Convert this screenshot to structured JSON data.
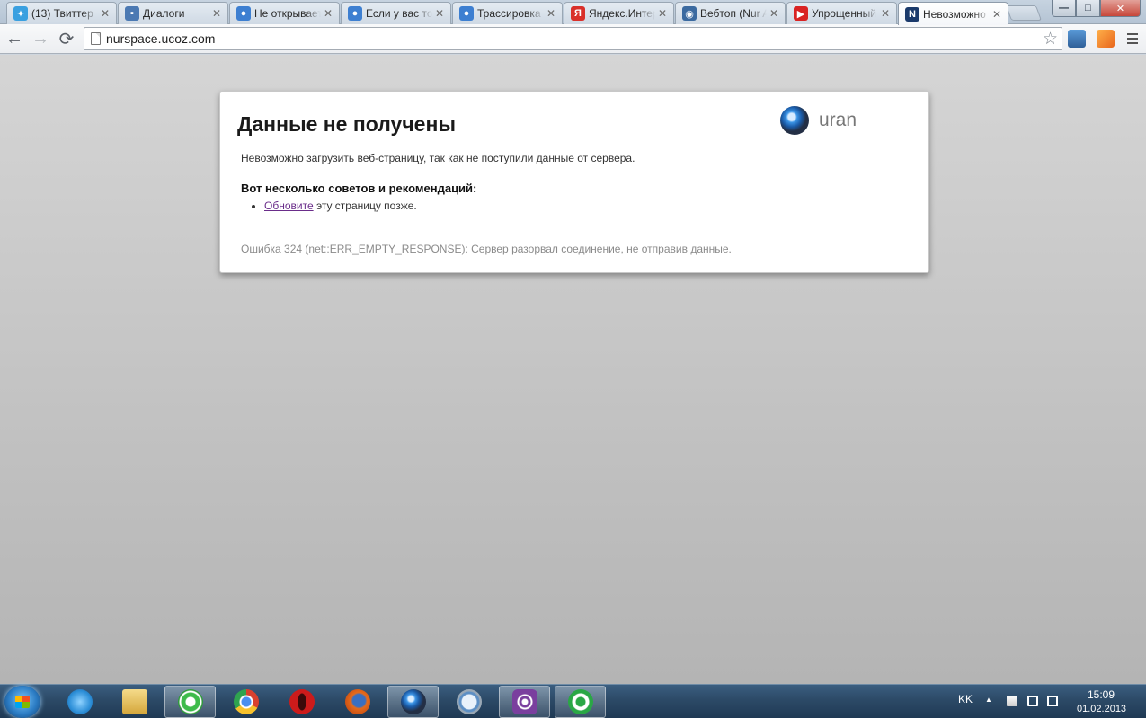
{
  "tabs": [
    {
      "label": "(13) Твиттер",
      "icon": "twitter-icon",
      "color": "#3aa0e0"
    },
    {
      "label": "Диалоги",
      "icon": "chat-icon",
      "color": "#4b79b3"
    },
    {
      "label": "Не открывается",
      "icon": "people-icon",
      "color": "#3d7fd1"
    },
    {
      "label": "Если у вас тормозит",
      "icon": "people-icon",
      "color": "#3d7fd1"
    },
    {
      "label": "Трассировка",
      "icon": "people-icon",
      "color": "#3d7fd1"
    },
    {
      "label": "Яндекс.Интернет",
      "icon": "yandex-icon",
      "color": "#d9302a"
    },
    {
      "label": "Вебтоп (Nur Astana)",
      "icon": "webtop-icon",
      "color": "#3b6aa0"
    },
    {
      "label": "Упрощенный",
      "icon": "youtube-icon",
      "color": "#d92323"
    },
    {
      "label": "Невозможно",
      "icon": "n-icon",
      "color": "#1b3a6b"
    }
  ],
  "window_controls": {
    "minimize": "—",
    "maximize": "□",
    "close": "✕"
  },
  "toolbar": {
    "back": "←",
    "forward": "→",
    "reload": "⟳",
    "url": "nurspace.ucoz.com",
    "star": "☆"
  },
  "error_page": {
    "title": "Данные не получены",
    "brand": "uran",
    "description": "Невозможно загрузить веб-страницу, так как не поступили данные от сервера.",
    "tips_heading": "Вот несколько советов и рекомендаций:",
    "tip_link": "Обновите",
    "tip_rest": " эту страницу позже.",
    "error_code": "Ошибка 324 (net::ERR_EMPTY_RESPONSE): Сервер разорвал соединение, не отправив данные."
  },
  "taskbar": {
    "apps": [
      {
        "name": "internet-explorer-icon",
        "color": "#2d8fd8"
      },
      {
        "name": "file-explorer-icon",
        "color": "#e8c25a"
      },
      {
        "name": "mail-agent-icon",
        "color": "#3dbb4a"
      },
      {
        "name": "chrome-icon",
        "color": "#d9412e"
      },
      {
        "name": "opera-icon",
        "color": "#cc1b1b"
      },
      {
        "name": "firefox-icon",
        "color": "#e66b1b"
      },
      {
        "name": "uran-icon",
        "color": "#2e78c9"
      },
      {
        "name": "safari-icon",
        "color": "#5d8fc4"
      },
      {
        "name": "wifi-app-icon",
        "color": "#7a3f9e"
      },
      {
        "name": "green-app-icon",
        "color": "#2aa745"
      }
    ],
    "language": "KK",
    "tray_arrow": "▲",
    "time": "15:09",
    "date": "01.02.2013"
  }
}
